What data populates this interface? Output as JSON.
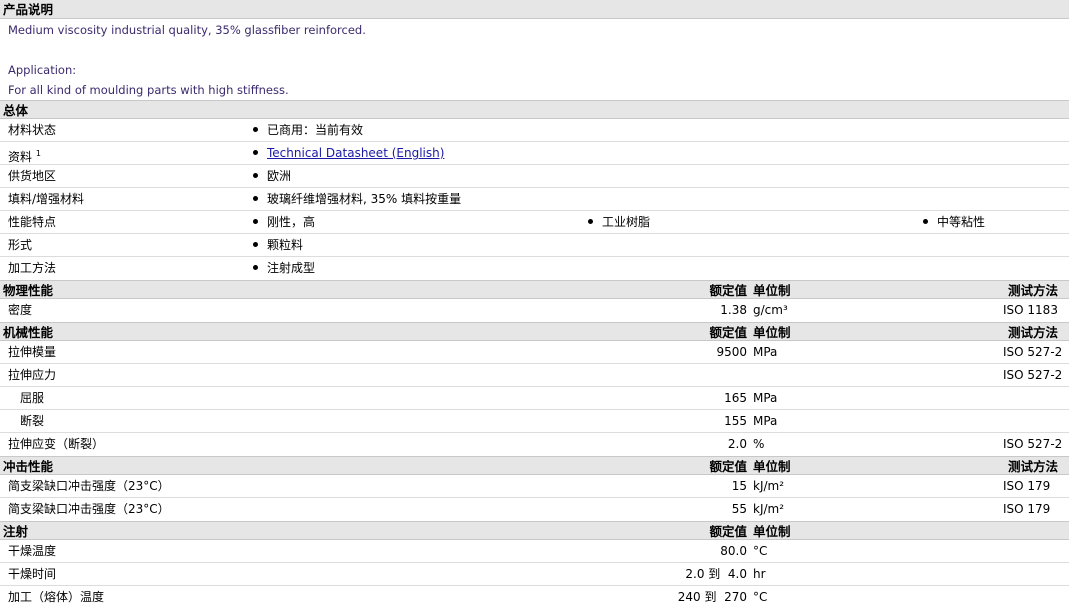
{
  "product": {
    "title": "产品说明",
    "line1": "Medium viscosity industrial quality, 35% glassfiber reinforced.",
    "line2": "Application:",
    "line3": "For all kind of moulding parts with high stiffness."
  },
  "general": {
    "title": "总体",
    "rows": [
      {
        "label": "材料状态",
        "items": [
          "已商用：当前有效"
        ]
      },
      {
        "label": "资料",
        "sup": "1",
        "items": [
          "Technical Datasheet (English)"
        ]
      },
      {
        "label": "供货地区",
        "items": [
          "欧洲"
        ]
      },
      {
        "label": "填料/增强材料",
        "items": [
          "玻璃纤维增强材料, 35% 填料按重量"
        ]
      },
      {
        "label": "性能特点",
        "items": [
          "刚性，高",
          "工业树脂",
          "中等粘性"
        ]
      },
      {
        "label": "形式",
        "items": [
          "颗粒料"
        ]
      },
      {
        "label": "加工方法",
        "items": [
          "注射成型"
        ]
      }
    ]
  },
  "headers": {
    "value": "额定值",
    "unit": "单位制",
    "method": "测试方法"
  },
  "physical": {
    "title": "物理性能",
    "rows": [
      {
        "label": "密度",
        "value": "1.38",
        "unit": "g/cm³",
        "method": "ISO 1183"
      }
    ]
  },
  "mechanical": {
    "title": "机械性能",
    "rows": [
      {
        "label": "拉伸模量",
        "value": "9500",
        "unit": "MPa",
        "method": "ISO 527-2"
      },
      {
        "label": "拉伸应力",
        "value": "",
        "unit": "",
        "method": "ISO 527-2"
      },
      {
        "label": "屈服",
        "value": "165",
        "unit": "MPa",
        "method": ""
      },
      {
        "label": "断裂",
        "value": "155",
        "unit": "MPa",
        "method": ""
      },
      {
        "label": "拉伸应变（断裂）",
        "value": "2.0",
        "unit": "%",
        "method": "ISO 527-2"
      }
    ]
  },
  "impact": {
    "title": "冲击性能",
    "rows": [
      {
        "label": "简支梁缺口冲击强度（23°C）",
        "value": "15",
        "unit": "kJ/m²",
        "method": "ISO 179"
      },
      {
        "label": "简支梁缺口冲击强度（23°C）",
        "value": "55",
        "unit": "kJ/m²",
        "method": "ISO 179"
      }
    ]
  },
  "injection": {
    "title": "注射",
    "rows": [
      {
        "label": "干燥温度",
        "value": "80.0",
        "unit": "°C",
        "method": ""
      },
      {
        "label": "干燥时间",
        "value": "2.0 到  4.0",
        "unit": "hr",
        "method": ""
      },
      {
        "label": "加工（熔体）温度",
        "value": "240 到  270",
        "unit": "°C",
        "method": ""
      }
    ]
  }
}
